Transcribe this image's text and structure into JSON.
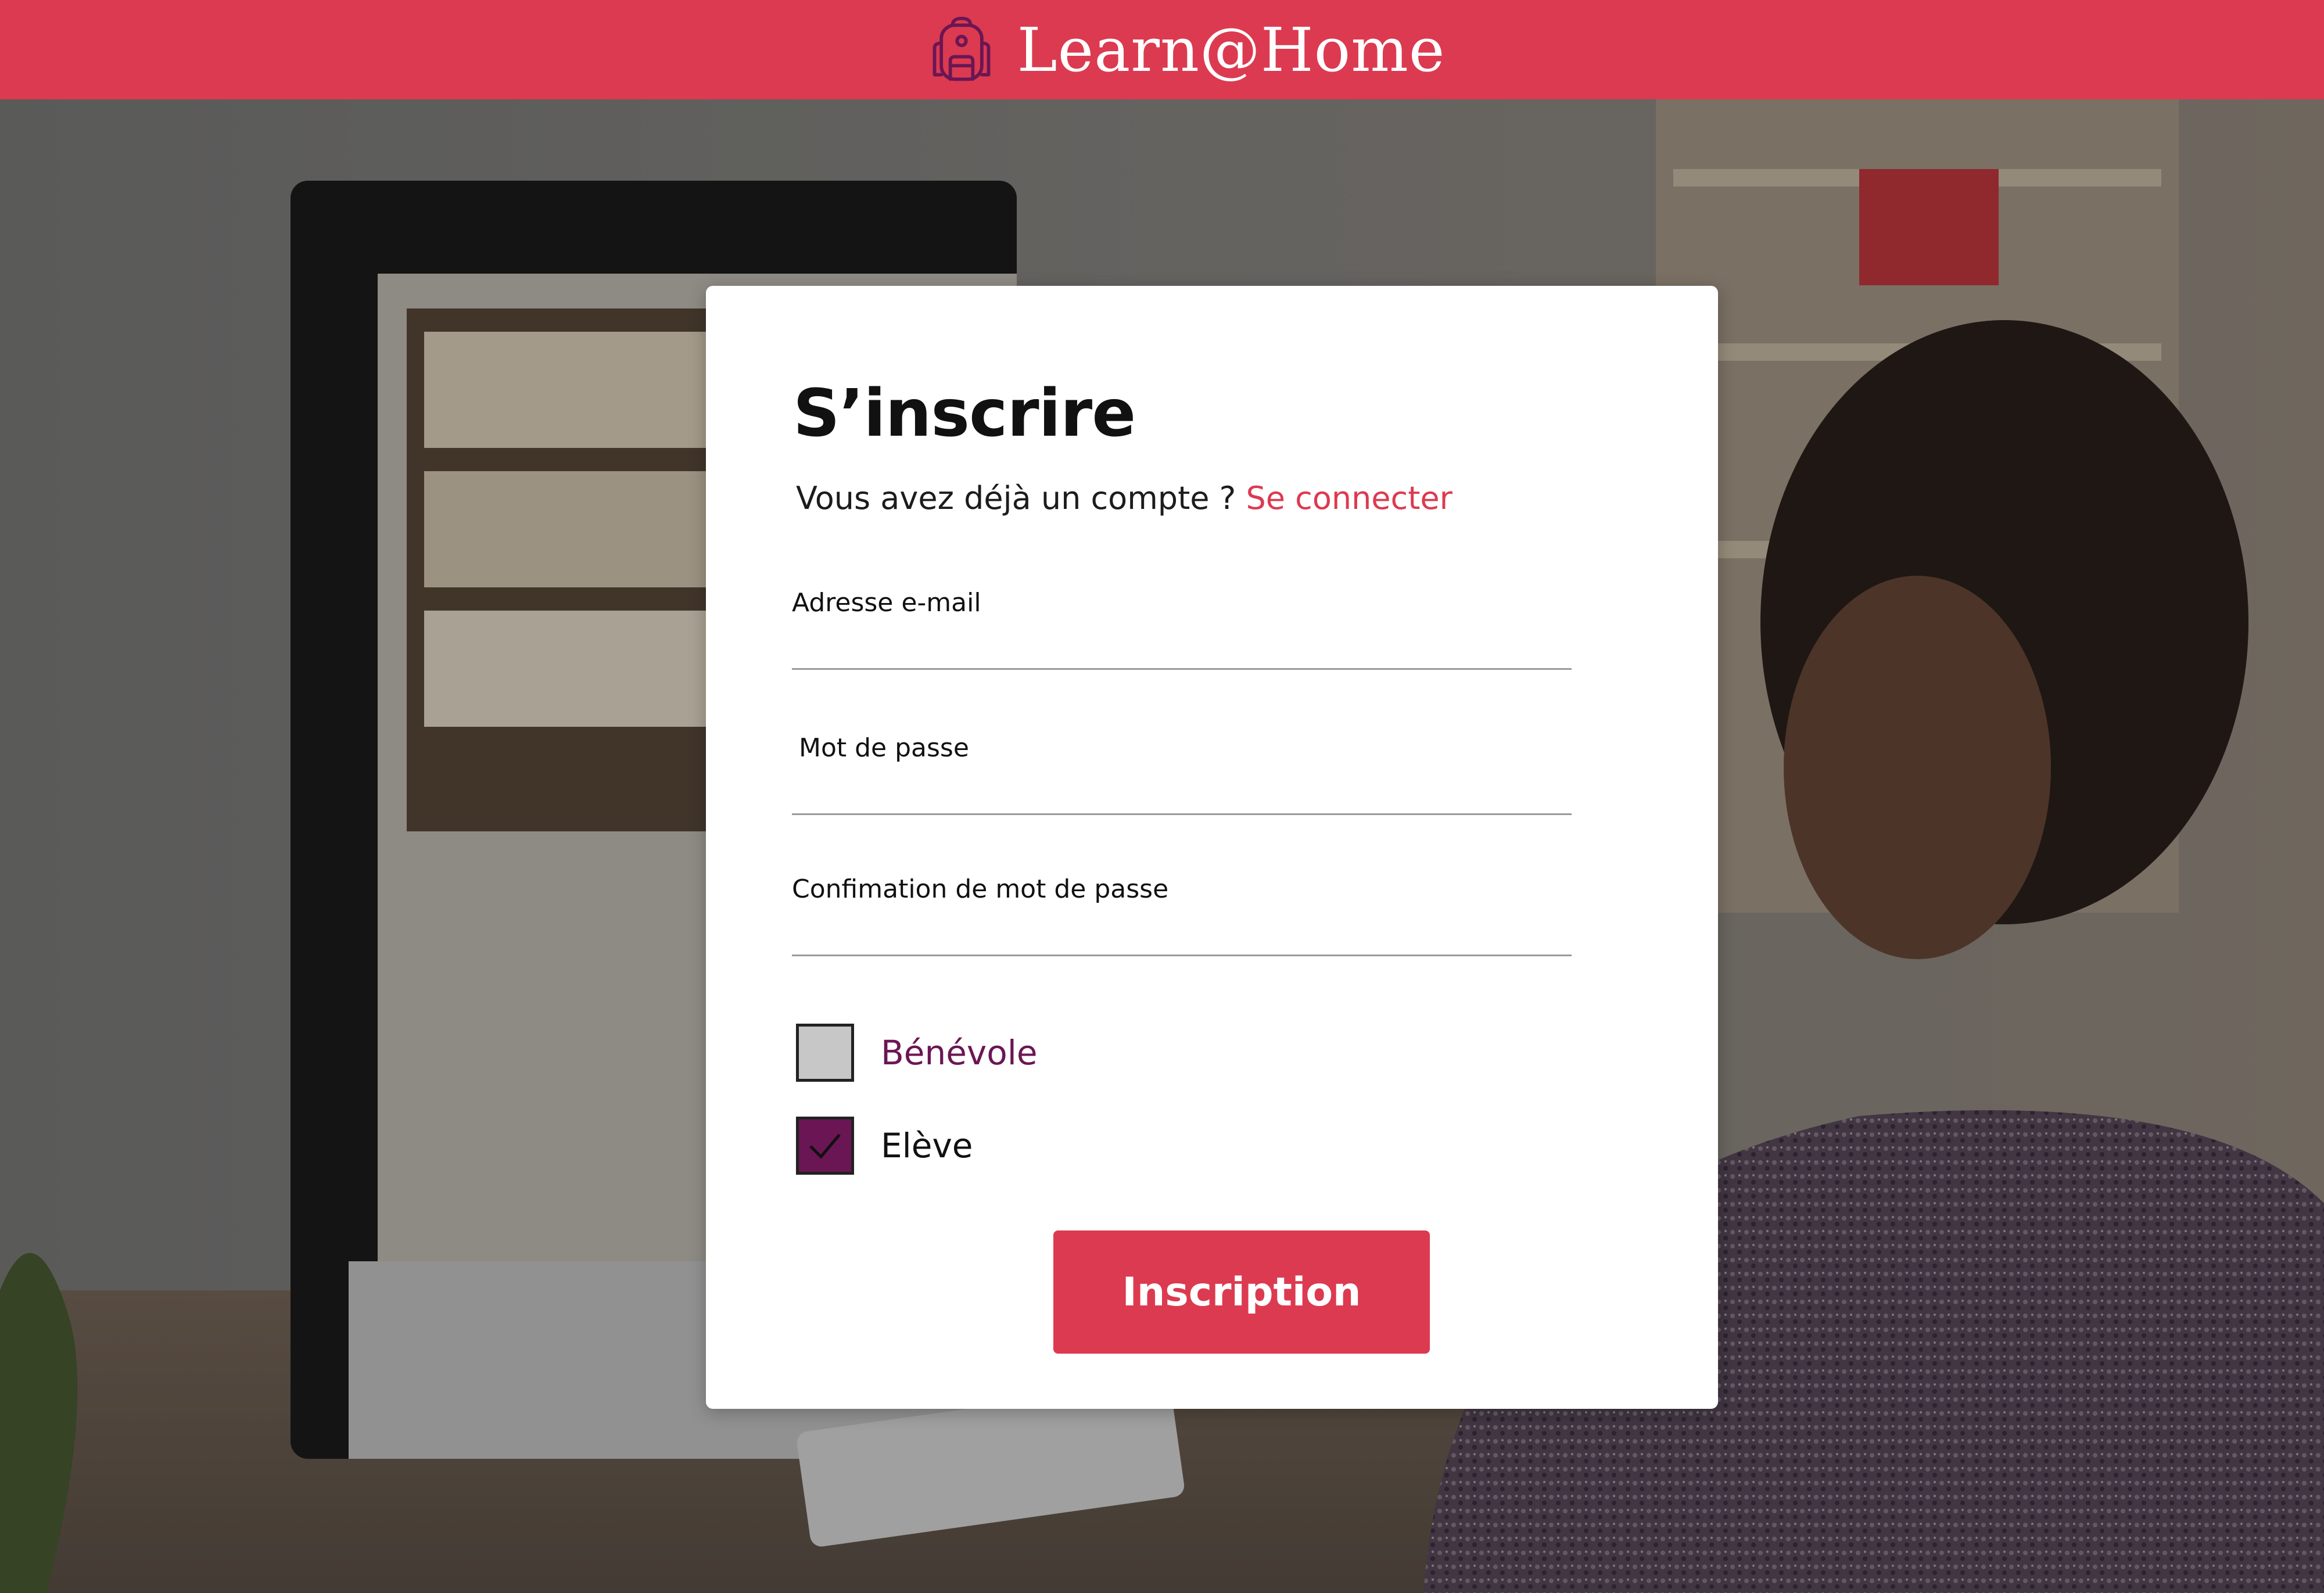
{
  "header": {
    "title": "Learn@Home",
    "icon": "backpack-icon",
    "background_color": "#dc3a50"
  },
  "form": {
    "title": "S’inscrire",
    "subtitle_prefix": "Vous avez déjà un compte ? ",
    "login_link": "Se connecter",
    "fields": [
      {
        "label": "Adresse e-mail",
        "value": ""
      },
      {
        "label": "Mot de passe",
        "value": ""
      },
      {
        "label": "Confimation de mot de passe",
        "value": ""
      }
    ],
    "roles": [
      {
        "label": "Bénévole",
        "checked": false
      },
      {
        "label": "Elève",
        "checked": true
      }
    ],
    "submit_label": "Inscription"
  },
  "colors": {
    "accent": "#dc3a50",
    "checkbox_checked": "#6b1654",
    "checkbox_unchecked": "#c7c7c7"
  }
}
